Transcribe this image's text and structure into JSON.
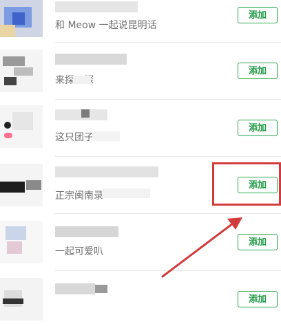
{
  "contacts": [
    {
      "subtitle": "和 Meow 一起说昆明话",
      "add_label": "添加"
    },
    {
      "subtitle": "来探一探",
      "add_label": "添加"
    },
    {
      "subtitle": "这只团子的",
      "add_label": "添加"
    },
    {
      "subtitle": "正宗闽南录",
      "add_label": "添加"
    },
    {
      "subtitle": "一起可爱叭",
      "add_label": "添加"
    },
    {
      "subtitle": "",
      "add_label": "添加"
    }
  ],
  "colors": {
    "accent": "#1f9a44",
    "highlight": "#d23b3b",
    "subtext": "#6f6f6f"
  }
}
